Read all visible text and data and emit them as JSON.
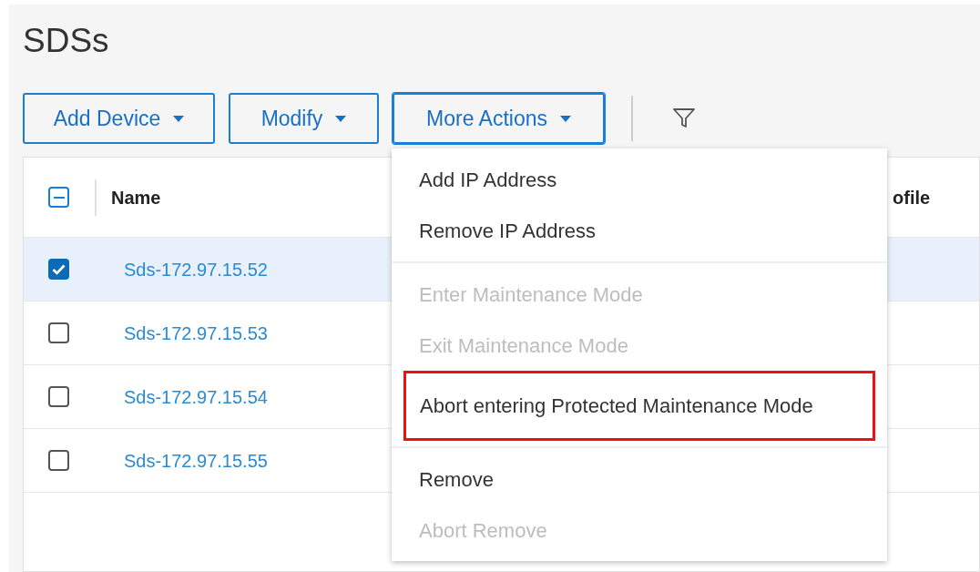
{
  "page_title": "SDSs",
  "toolbar": {
    "buttons": [
      {
        "label": "Add Device",
        "expanded": false
      },
      {
        "label": "Modify",
        "expanded": false
      },
      {
        "label": "More Actions",
        "expanded": true
      }
    ]
  },
  "table": {
    "select_all": {
      "indeterminate": true
    },
    "columns": [
      "Name",
      "ofile"
    ],
    "rows": [
      {
        "name": "Sds-172.97.15.52",
        "checked": true,
        "selected": true
      },
      {
        "name": "Sds-172.97.15.53",
        "checked": false,
        "selected": false
      },
      {
        "name": "Sds-172.97.15.54",
        "checked": false,
        "selected": false
      },
      {
        "name": "Sds-172.97.15.55",
        "checked": false,
        "selected": false
      }
    ]
  },
  "menu": {
    "groups": [
      [
        {
          "label": "Add IP Address",
          "disabled": false,
          "highlighted": false
        },
        {
          "label": "Remove IP Address",
          "disabled": false,
          "highlighted": false
        }
      ],
      [
        {
          "label": "Enter Maintenance Mode",
          "disabled": true,
          "highlighted": false
        },
        {
          "label": "Exit Maintenance Mode",
          "disabled": true,
          "highlighted": false
        },
        {
          "label": "Abort entering Protected Maintenance Mode",
          "disabled": false,
          "highlighted": true
        }
      ],
      [
        {
          "label": "Remove",
          "disabled": false,
          "highlighted": false
        },
        {
          "label": "Abort Remove",
          "disabled": true,
          "highlighted": false
        }
      ]
    ]
  }
}
